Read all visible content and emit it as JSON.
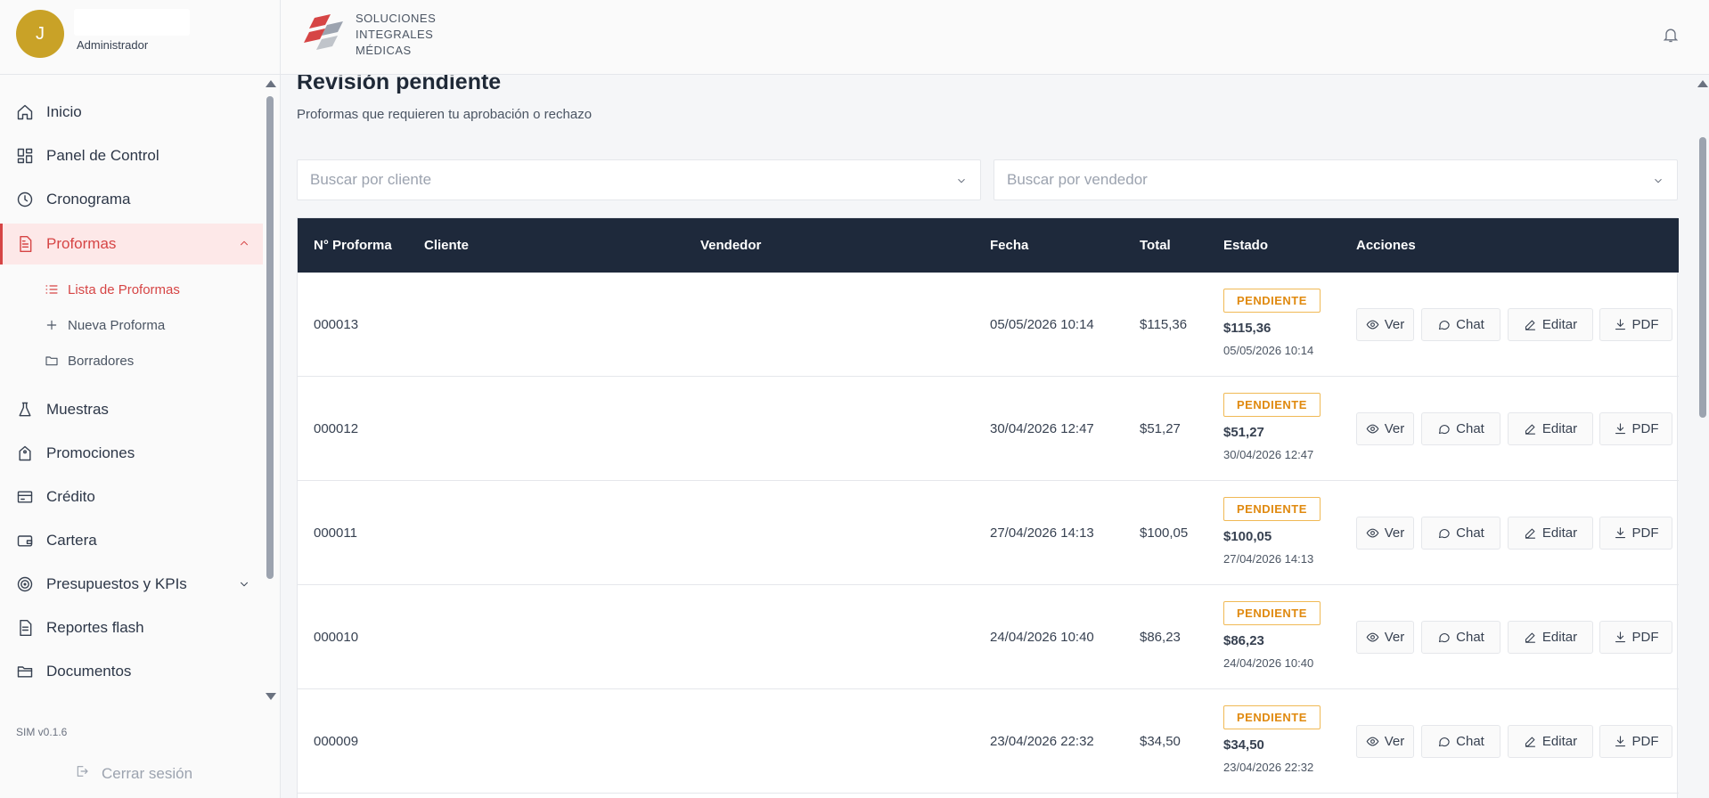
{
  "user": {
    "initial": "J",
    "role": "Administrador"
  },
  "brand": {
    "line1": "SOLUCIONES",
    "line2": "INTEGRALES",
    "line3": "MÉDICAS",
    "color_red": "#d64545",
    "color_gray": "#9ca3af"
  },
  "sidebar": {
    "items": [
      {
        "label": "Inicio",
        "icon": "home-icon"
      },
      {
        "label": "Panel de Control",
        "icon": "dashboard-icon"
      },
      {
        "label": "Cronograma",
        "icon": "clock-icon"
      },
      {
        "label": "Proformas",
        "icon": "document-icon",
        "active": true,
        "expanded": true
      },
      {
        "label": "Muestras",
        "icon": "flask-icon"
      },
      {
        "label": "Promociones",
        "icon": "tag-icon"
      },
      {
        "label": "Crédito",
        "icon": "credit-card-icon"
      },
      {
        "label": "Cartera",
        "icon": "wallet-icon"
      },
      {
        "label": "Presupuestos y KPIs",
        "icon": "target-icon",
        "expandable": true
      },
      {
        "label": "Reportes flash",
        "icon": "report-icon"
      },
      {
        "label": "Documentos",
        "icon": "folder-open-icon"
      }
    ],
    "sub_items": [
      {
        "label": "Lista de Proformas",
        "icon": "list-icon",
        "active": true
      },
      {
        "label": "Nueva Proforma",
        "icon": "plus-icon"
      },
      {
        "label": "Borradores",
        "icon": "folder-icon"
      }
    ],
    "version": "SIM v0.1.6",
    "logout_label": "Cerrar sesión"
  },
  "page": {
    "title": "Revisión pendiente",
    "subtitle": "Proformas que requieren tu aprobación o rechazo"
  },
  "filters": {
    "client_placeholder": "Buscar por cliente",
    "seller_placeholder": "Buscar por vendedor"
  },
  "table": {
    "headers": {
      "number": "N° Proforma",
      "client": "Cliente",
      "seller": "Vendedor",
      "date": "Fecha",
      "total": "Total",
      "status": "Estado",
      "actions": "Acciones"
    },
    "actions": {
      "view": "Ver",
      "chat": "Chat",
      "edit": "Editar",
      "pdf": "PDF"
    },
    "rows": [
      {
        "number": "000013",
        "client": "",
        "seller": "",
        "date": "05/05/2026 10:14",
        "total": "$115,36",
        "status": "PENDIENTE",
        "status_total": "$115,36",
        "status_date": "05/05/2026 10:14"
      },
      {
        "number": "000012",
        "client": "",
        "seller": "",
        "date": "30/04/2026 12:47",
        "total": "$51,27",
        "status": "PENDIENTE",
        "status_total": "$51,27",
        "status_date": "30/04/2026 12:47"
      },
      {
        "number": "000011",
        "client": "",
        "seller": "",
        "date": "27/04/2026 14:13",
        "total": "$100,05",
        "status": "PENDIENTE",
        "status_total": "$100,05",
        "status_date": "27/04/2026 14:13"
      },
      {
        "number": "000010",
        "client": "",
        "seller": "",
        "date": "24/04/2026 10:40",
        "total": "$86,23",
        "status": "PENDIENTE",
        "status_total": "$86,23",
        "status_date": "24/04/2026 10:40"
      },
      {
        "number": "000009",
        "client": "",
        "seller": "",
        "date": "23/04/2026 22:32",
        "total": "$34,50",
        "status": "PENDIENTE",
        "status_total": "$34,50",
        "status_date": "23/04/2026 22:32"
      }
    ]
  },
  "colors": {
    "header_dark": "#1e293b",
    "pending": "#e08a10",
    "active": "#d64545",
    "avatar": "#c9a227"
  }
}
